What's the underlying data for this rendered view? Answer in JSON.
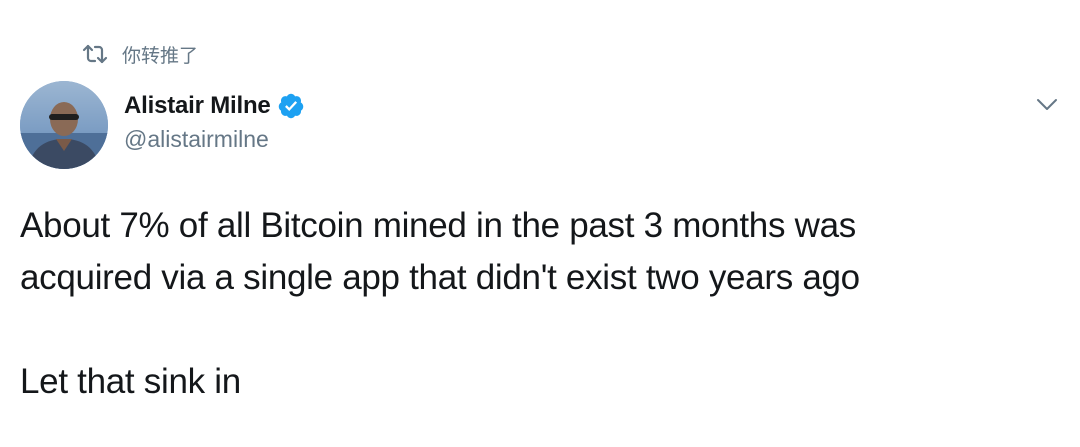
{
  "retweet_context": {
    "icon": "retweet-icon",
    "text": "你转推了"
  },
  "author": {
    "avatar": "avatar",
    "display_name": "Alistair Milne",
    "verified_icon": "verified-badge-icon",
    "handle": "@alistairmilne"
  },
  "menu": {
    "icon": "chevron-down-icon"
  },
  "tweet": {
    "lines": [
      "About 7% of all Bitcoin mined in the past 3 months was",
      "acquired via a single app that didn't exist two years ago",
      "Let that sink in"
    ]
  },
  "colors": {
    "text_primary": "#14171a",
    "text_secondary": "#657786",
    "verified_blue": "#1da1f2"
  }
}
